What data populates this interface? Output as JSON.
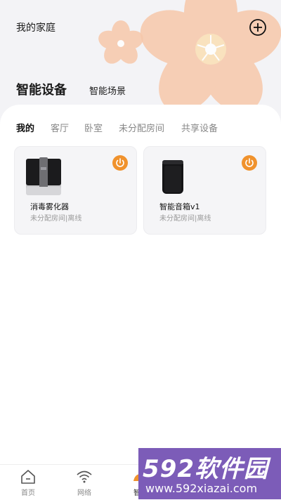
{
  "header": {
    "title": "我的家庭"
  },
  "main_tabs": [
    {
      "label": "智能设备",
      "active": true
    },
    {
      "label": "智能场景",
      "active": false
    }
  ],
  "room_tabs": [
    {
      "label": "我的",
      "active": true
    },
    {
      "label": "客厅",
      "active": false
    },
    {
      "label": "卧室",
      "active": false
    },
    {
      "label": "未分配房间",
      "active": false
    },
    {
      "label": "共享设备",
      "active": false
    }
  ],
  "devices": [
    {
      "name": "消毒雾化器",
      "status": "未分配房间|离线",
      "icon": "disinfection-atomizer"
    },
    {
      "name": "智能音箱v1",
      "status": "未分配房间|离线",
      "icon": "smart-speaker"
    }
  ],
  "tabbar": [
    {
      "label": "首页",
      "icon": "home-icon"
    },
    {
      "label": "网络",
      "icon": "wifi-icon"
    },
    {
      "label": "智能",
      "icon": "smart-icon",
      "active": true
    },
    {
      "label": "",
      "icon": "shop-icon"
    },
    {
      "label": "",
      "icon": "user-icon"
    }
  ],
  "watermark": {
    "big": "592软件园",
    "small": "www.592xiazai.com"
  },
  "colors": {
    "accent": "#f0922d",
    "flower": "#f7c6a6",
    "watermark": "#7c5cb8"
  }
}
